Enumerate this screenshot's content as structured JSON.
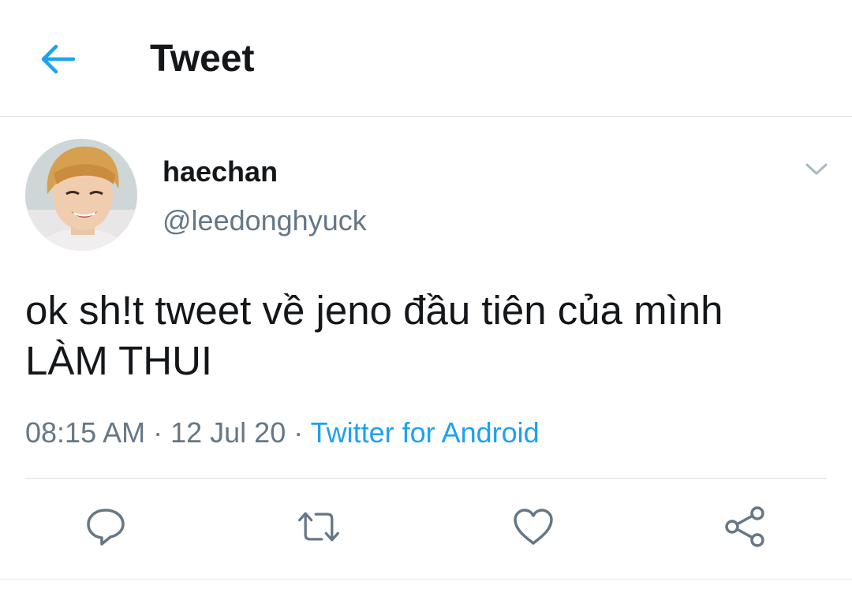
{
  "header": {
    "title": "Tweet",
    "back_icon": "back-arrow-icon"
  },
  "tweet": {
    "display_name": "haechan",
    "handle": "@leedonghyuck",
    "text_line1": "ok sh!t tweet về jeno đầu tiên của mình",
    "text_line2": "LÀM THUI",
    "time": "08:15 AM",
    "separator": " · ",
    "date": "12 Jul 20",
    "source": "Twitter for Android"
  },
  "actions": [
    {
      "name": "reply",
      "icon": "reply-icon"
    },
    {
      "name": "retweet",
      "icon": "retweet-icon"
    },
    {
      "name": "like",
      "icon": "heart-icon"
    },
    {
      "name": "share",
      "icon": "share-icon"
    }
  ],
  "colors": {
    "accent": "#1da1f2",
    "text": "#14171a",
    "secondary": "#657786",
    "icon": "#657786",
    "divider": "#dcdfe2"
  }
}
